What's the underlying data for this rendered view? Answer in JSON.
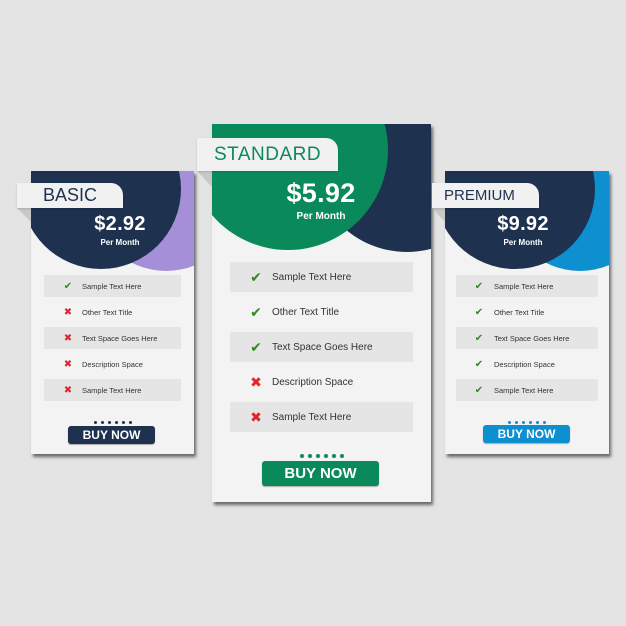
{
  "colors": {
    "background": "#e4e4e4",
    "navy": "#1e3250",
    "purple": "#a48fd8",
    "green": "#0a8a5a",
    "blue": "#0d8fd0",
    "check": "#2e8b1e",
    "cross": "#e0252c"
  },
  "icons": {
    "check": "✔",
    "cross": "✖"
  },
  "plans": [
    {
      "name": "BASIC",
      "price": "$2.92",
      "period": "Per Month",
      "features": [
        {
          "label": "Sample Text Here",
          "included": true,
          "icon": "check-icon"
        },
        {
          "label": "Other Text Title",
          "included": false,
          "icon": "cross-icon"
        },
        {
          "label": "Text Space Goes Here",
          "included": false,
          "icon": "cross-icon"
        },
        {
          "label": "Description Space",
          "included": false,
          "icon": "cross-icon"
        },
        {
          "label": "Sample Text Here",
          "included": false,
          "icon": "cross-icon"
        }
      ],
      "dots": 6,
      "button_label": "BUY NOW"
    },
    {
      "name": "STANDARD",
      "price": "$5.92",
      "period": "Per Month",
      "features": [
        {
          "label": "Sample Text Here",
          "included": true,
          "icon": "check-icon"
        },
        {
          "label": "Other Text Title",
          "included": true,
          "icon": "check-icon"
        },
        {
          "label": "Text Space Goes Here",
          "included": true,
          "icon": "check-icon"
        },
        {
          "label": "Description Space",
          "included": false,
          "icon": "cross-icon"
        },
        {
          "label": "Sample Text Here",
          "included": false,
          "icon": "cross-icon"
        }
      ],
      "dots": 6,
      "button_label": "BUY NOW"
    },
    {
      "name": "PREMIUM",
      "price": "$9.92",
      "period": "Per Month",
      "features": [
        {
          "label": "Sample Text Here",
          "included": true,
          "icon": "check-icon"
        },
        {
          "label": "Other Text Title",
          "included": true,
          "icon": "check-icon"
        },
        {
          "label": "Text Space Goes Here",
          "included": true,
          "icon": "check-icon"
        },
        {
          "label": "Description Space",
          "included": true,
          "icon": "check-icon"
        },
        {
          "label": "Sample Text Here",
          "included": true,
          "icon": "check-icon"
        }
      ],
      "dots": 6,
      "button_label": "BUY NOW"
    }
  ]
}
